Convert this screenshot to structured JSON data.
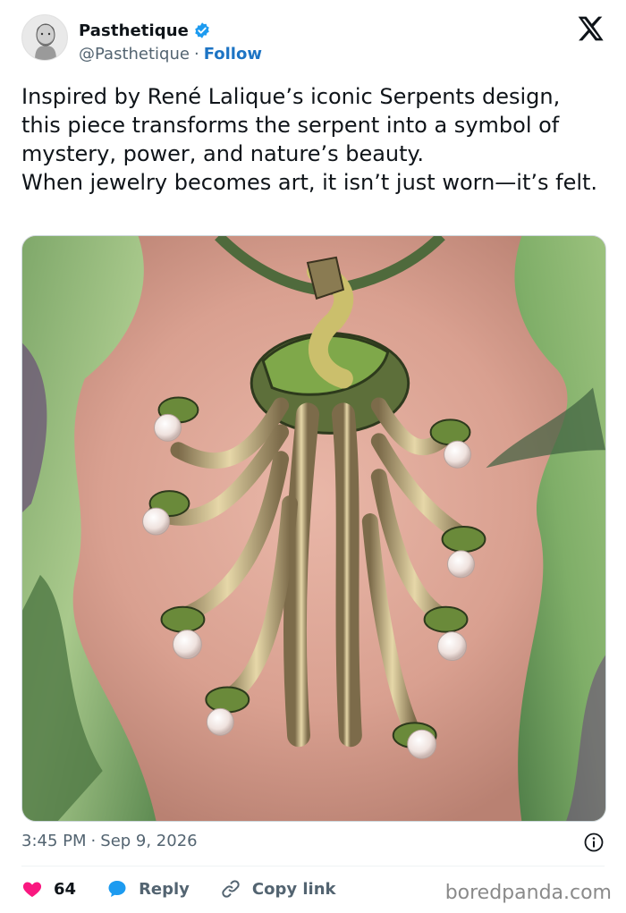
{
  "author": {
    "display_name": "Pasthetique",
    "handle": "@Pasthetique",
    "separator": "·",
    "follow_label": "Follow",
    "verified": true
  },
  "tweet": {
    "text": "Inspired by René Lalique’s iconic Serpents design, this piece transforms the serpent into a symbol of mystery, power, and nature’s beauty.\nWhen jewelry becomes art, it isn’t just worn—it’s felt.",
    "time": "3:45 PM",
    "date": "Sep 9, 2026",
    "separator": "·"
  },
  "actions": {
    "likes": "64",
    "reply_label": "Reply",
    "copy_label": "Copy link"
  },
  "watermark": "boredpanda.com",
  "colors": {
    "like": "#f91880",
    "reply": "#1d9bf0",
    "verified": "#1d9bf0",
    "follow": "#1d74c4",
    "muted": "#536471"
  },
  "icons": {
    "like": "heart-icon",
    "reply": "speech-bubble-icon",
    "copy": "link-icon",
    "info": "info-icon",
    "brand": "x-logo-icon",
    "verified": "verified-badge-icon"
  }
}
